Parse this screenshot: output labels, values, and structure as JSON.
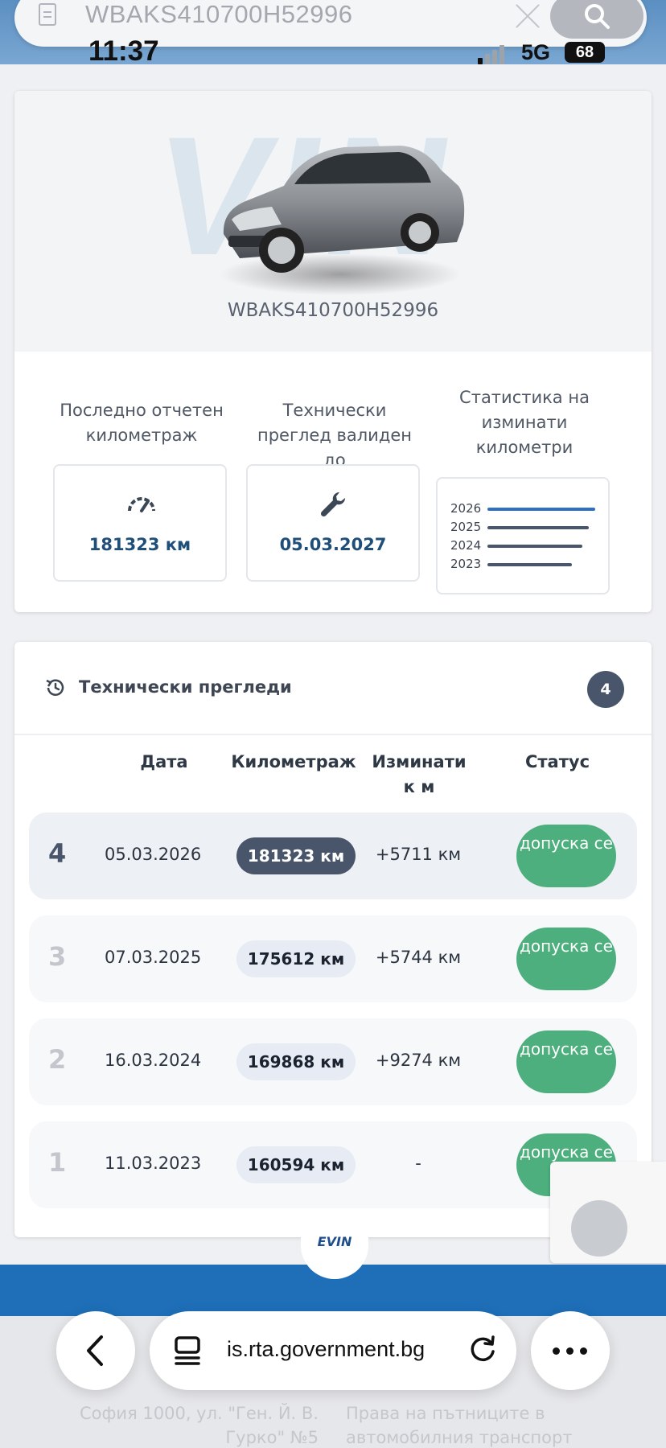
{
  "browser": {
    "search_value": "WBAKS410700H52996",
    "url": "is.rta.government.bg"
  },
  "status_bar": {
    "time": "11:37",
    "network": "5G",
    "battery": "68"
  },
  "vehicle": {
    "vin": "WBAKS410700H52996",
    "watermark": "VIN"
  },
  "stats": {
    "mileage_label": "Последно отчетен километраж",
    "mileage_value": "181323 км",
    "inspection_label": "Технически преглед валиден до",
    "inspection_value": "05.03.2027",
    "chart_label": "Статистика на изминати километри",
    "mini_chart": [
      {
        "year": "2026",
        "value": 181323,
        "color": "#2f6fc4"
      },
      {
        "year": "2025",
        "value": 175612,
        "color": "#48556a"
      },
      {
        "year": "2024",
        "value": 169868,
        "color": "#48556a"
      },
      {
        "year": "2023",
        "value": 160594,
        "color": "#48556a"
      }
    ]
  },
  "inspections": {
    "title": "Технически прегледи",
    "count": "4",
    "columns": {
      "date": "Дата",
      "mileage": "Километраж",
      "traveled": "Изминати к м",
      "status": "Статус"
    },
    "rows": [
      {
        "num": "4",
        "date": "05.03.2026",
        "km": "181323 км",
        "diff": "+5711 км",
        "status": "допуска се",
        "current": true
      },
      {
        "num": "3",
        "date": "07.03.2025",
        "km": "175612 км",
        "diff": "+5744 км",
        "status": "допуска се",
        "current": false
      },
      {
        "num": "2",
        "date": "16.03.2024",
        "km": "169868 км",
        "diff": "+9274 км",
        "status": "допуска се",
        "current": false
      },
      {
        "num": "1",
        "date": "11.03.2023",
        "km": "160594 км",
        "diff": "-",
        "status": "допуска се",
        "current": false
      }
    ]
  },
  "footer": {
    "logo": "EVIN",
    "address": "София 1000, ул. \"Ген. Й. В. Гурко\" №5",
    "agency": "Права на пътниците в автомобилния транспорт"
  },
  "colors": {
    "accent": "#48556a",
    "status_ok": "#4caf7d",
    "value_text": "#1f4e79",
    "footer_blue": "#1e6fb8"
  },
  "icons": [
    "document-icon",
    "clear-icon",
    "search-icon",
    "gauge-icon",
    "wrench-icon",
    "history-icon",
    "back-icon",
    "tabs-icon",
    "reload-icon",
    "more-icon"
  ]
}
